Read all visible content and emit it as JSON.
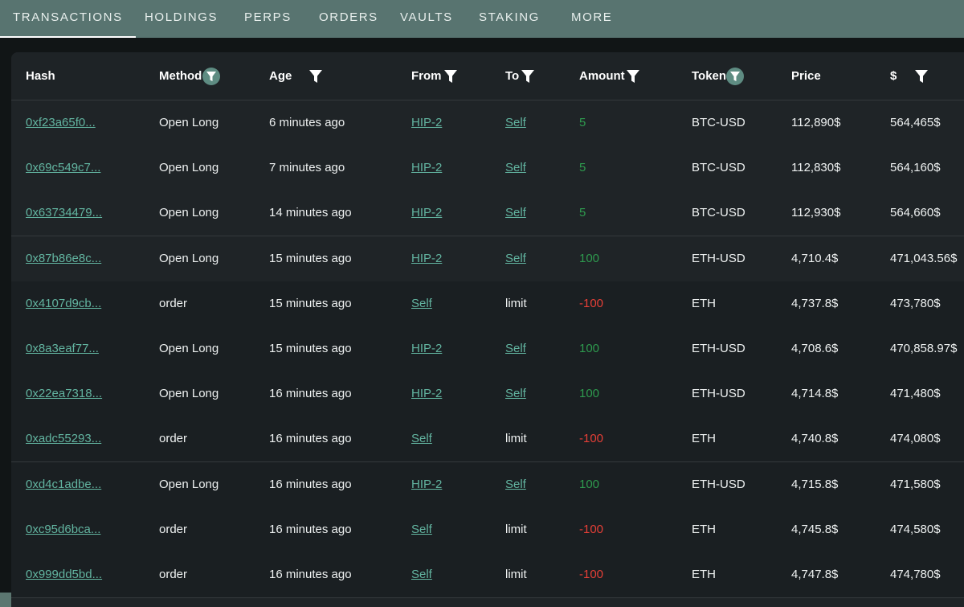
{
  "tabs": [
    {
      "label": "TRANSACTIONS",
      "active": true
    },
    {
      "label": "HOLDINGS",
      "active": false
    },
    {
      "label": "PERPS",
      "active": false
    },
    {
      "label": "ORDERS",
      "active": false
    },
    {
      "label": "VAULTS",
      "active": false
    },
    {
      "label": "STAKING",
      "active": false
    },
    {
      "label": "MORE",
      "active": false
    }
  ],
  "table": {
    "headers": {
      "hash": "Hash",
      "method": "Method",
      "age": "Age",
      "from": "From",
      "to": "To",
      "amount": "Amount",
      "token": "Token",
      "price": "Price",
      "usd": "$"
    },
    "rows": [
      {
        "hash": "0xf23a65f0...",
        "method": "Open Long",
        "age": "6 minutes ago",
        "from": "HIP-2",
        "to": "Self",
        "amount": "5",
        "token": "BTC-USD",
        "price": "112,890$",
        "usd": "564,465$"
      },
      {
        "hash": "0x69c549c7...",
        "method": "Open Long",
        "age": "7 minutes ago",
        "from": "HIP-2",
        "to": "Self",
        "amount": "5",
        "token": "BTC-USD",
        "price": "112,830$",
        "usd": "564,160$"
      },
      {
        "hash": "0x63734479...",
        "method": "Open Long",
        "age": "14 minutes ago",
        "from": "HIP-2",
        "to": "Self",
        "amount": "5",
        "token": "BTC-USD",
        "price": "112,930$",
        "usd": "564,660$"
      },
      {
        "hash": "0x87b86e8c...",
        "method": "Open Long",
        "age": "15 minutes ago",
        "from": "HIP-2",
        "to": "Self",
        "amount": "100",
        "token": "ETH-USD",
        "price": "4,710.4$",
        "usd": "471,043.56$"
      },
      {
        "hash": "0x4107d9cb...",
        "method": "order",
        "age": "15 minutes ago",
        "from": "Self",
        "to": "limit",
        "amount": "-100",
        "token": "ETH",
        "price": "4,737.8$",
        "usd": "473,780$"
      },
      {
        "hash": "0x8a3eaf77...",
        "method": "Open Long",
        "age": "15 minutes ago",
        "from": "HIP-2",
        "to": "Self",
        "amount": "100",
        "token": "ETH-USD",
        "price": "4,708.6$",
        "usd": "470,858.97$"
      },
      {
        "hash": "0x22ea7318...",
        "method": "Open Long",
        "age": "16 minutes ago",
        "from": "HIP-2",
        "to": "Self",
        "amount": "100",
        "token": "ETH-USD",
        "price": "4,714.8$",
        "usd": "471,480$"
      },
      {
        "hash": "0xadc55293...",
        "method": "order",
        "age": "16 minutes ago",
        "from": "Self",
        "to": "limit",
        "amount": "-100",
        "token": "ETH",
        "price": "4,740.8$",
        "usd": "474,080$"
      },
      {
        "hash": "0xd4c1adbe...",
        "method": "Open Long",
        "age": "16 minutes ago",
        "from": "HIP-2",
        "to": "Self",
        "amount": "100",
        "token": "ETH-USD",
        "price": "4,715.8$",
        "usd": "471,580$"
      },
      {
        "hash": "0xc95d6bca...",
        "method": "order",
        "age": "16 minutes ago",
        "from": "Self",
        "to": "limit",
        "amount": "-100",
        "token": "ETH",
        "price": "4,745.8$",
        "usd": "474,580$"
      },
      {
        "hash": "0x999dd5bd...",
        "method": "order",
        "age": "16 minutes ago",
        "from": "Self",
        "to": "limit",
        "amount": "-100",
        "token": "ETH",
        "price": "4,747.8$",
        "usd": "474,780$"
      }
    ]
  },
  "colors": {
    "link": "#62b4a0",
    "positive": "#2e9a4e",
    "negative": "#e63f37",
    "tabbar": "#587470",
    "filter_ring": "#5e8c82"
  },
  "icons": {
    "filter": "funnel-filter-icon",
    "filter_active": "funnel-filter-ring-icon"
  }
}
